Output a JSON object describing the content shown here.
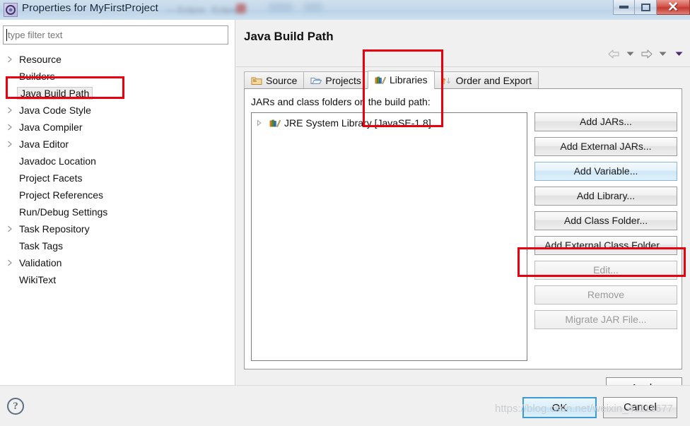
{
  "window": {
    "title": "Properties for MyFirstProject",
    "app_icon": "eclipse-icon",
    "ghost_text_1": "— Eclipse",
    "ghost_text_2": "Eclipse",
    "controls": {
      "minimize": "minimize-button",
      "restore": "restore-button",
      "close_glyph": "✕"
    }
  },
  "sidebar": {
    "filter": {
      "value": "",
      "placeholder": "type filter text"
    },
    "items": [
      {
        "label": "Resource",
        "expandable": true,
        "selected": false
      },
      {
        "label": "Builders",
        "expandable": false,
        "selected": false
      },
      {
        "label": "Java Build Path",
        "expandable": false,
        "selected": true
      },
      {
        "label": "Java Code Style",
        "expandable": true,
        "selected": false
      },
      {
        "label": "Java Compiler",
        "expandable": true,
        "selected": false
      },
      {
        "label": "Java Editor",
        "expandable": true,
        "selected": false
      },
      {
        "label": "Javadoc Location",
        "expandable": false,
        "selected": false
      },
      {
        "label": "Project Facets",
        "expandable": false,
        "selected": false
      },
      {
        "label": "Project References",
        "expandable": false,
        "selected": false
      },
      {
        "label": "Run/Debug Settings",
        "expandable": false,
        "selected": false
      },
      {
        "label": "Task Repository",
        "expandable": true,
        "selected": false
      },
      {
        "label": "Task Tags",
        "expandable": false,
        "selected": false
      },
      {
        "label": "Validation",
        "expandable": true,
        "selected": false
      },
      {
        "label": "WikiText",
        "expandable": false,
        "selected": false
      }
    ]
  },
  "page": {
    "title": "Java Build Path",
    "nav": {
      "back": "back-arrow-icon",
      "back_menu": "chevron-down-icon",
      "forward": "forward-arrow-icon",
      "forward_menu": "chevron-down-icon",
      "view_menu": "view-menu-icon"
    },
    "tabs": [
      {
        "label": "Source",
        "icon": "source-folder-icon",
        "active": false
      },
      {
        "label": "Projects",
        "icon": "open-folder-icon",
        "active": false
      },
      {
        "label": "Libraries",
        "icon": "library-books-icon",
        "active": true
      },
      {
        "label": "Order and Export",
        "icon": "order-export-icon",
        "active": false
      }
    ],
    "libraries_tab": {
      "list_label": "JARs and class folders on the build path:",
      "entries": [
        {
          "label": "JRE System Library [JavaSE-1.8]",
          "icon": "library-books-icon",
          "expandable": true
        }
      ],
      "buttons": [
        {
          "label": "Add JARs...",
          "state": "normal"
        },
        {
          "label": "Add External JARs...",
          "state": "normal"
        },
        {
          "label": "Add Variable...",
          "state": "hover"
        },
        {
          "label": "Add Library...",
          "state": "normal"
        },
        {
          "label": "Add Class Folder...",
          "state": "normal"
        },
        {
          "label": "Add External Class Folder...",
          "state": "normal"
        },
        {
          "label": "Edit...",
          "state": "disabled"
        },
        {
          "label": "Remove",
          "state": "disabled"
        },
        {
          "label": "Migrate JAR File...",
          "state": "disabled"
        }
      ]
    },
    "apply_label": "Apply"
  },
  "footer": {
    "help_icon": "help-question-icon",
    "help_glyph": "?",
    "ok_label": "OK",
    "cancel_label": "Cancel"
  },
  "watermark": {
    "text": "https://blog.csdn.net/weixin_41111677"
  },
  "annotations": {
    "accent_color": "#e8000f",
    "boxes": [
      {
        "name": "java-build-path-highlight",
        "target": "Java Build Path"
      },
      {
        "name": "libraries-tab-highlight",
        "target": "Libraries"
      },
      {
        "name": "edit-button-highlight",
        "target": "Edit..."
      }
    ]
  },
  "colors": {
    "titlebar": "#c3d8ea",
    "dialog_bg": "#f0f0f0",
    "panel_bg": "#ffffff",
    "close_button": "#c23a32",
    "default_button_border": "#3c9ad6"
  }
}
